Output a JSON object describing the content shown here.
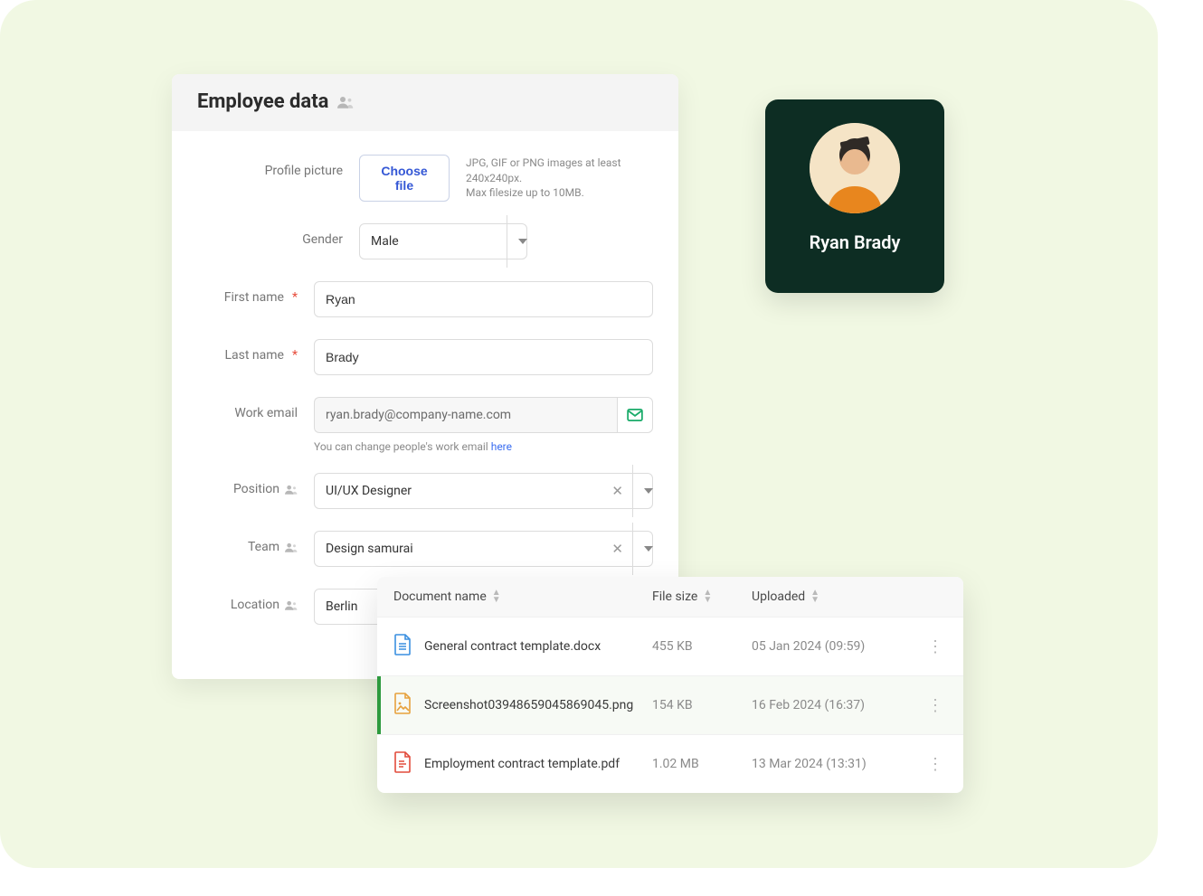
{
  "form": {
    "title": "Employee data",
    "labels": {
      "profile_picture": "Profile picture",
      "gender": "Gender",
      "first_name": "First name",
      "last_name": "Last name",
      "work_email": "Work email",
      "position": "Position",
      "team": "Team",
      "location": "Location"
    },
    "choose_file": "Choose file",
    "picture_hint_line1": "JPG, GIF or PNG images at least 240x240px.",
    "picture_hint_line2": "Max filesize up to 10MB.",
    "gender_value": "Male",
    "first_name_value": "Ryan",
    "last_name_value": "Brady",
    "work_email_value": "ryan.brady@company-name.com",
    "email_hint_prefix": "You can change people's work email ",
    "email_hint_link": "here",
    "position_value": "UI/UX Designer",
    "team_value": "Design samurai",
    "location_value": "Berlin"
  },
  "profile": {
    "name": "Ryan Brady"
  },
  "documents": {
    "headers": {
      "name": "Document name",
      "size": "File size",
      "uploaded": "Uploaded"
    },
    "rows": [
      {
        "icon_color": "#3a8fe0",
        "type": "doc",
        "name": "General contract template.docx",
        "size": "455 KB",
        "uploaded": "05 Jan 2024 (09:59)",
        "active": false
      },
      {
        "icon_color": "#e7a13d",
        "type": "img",
        "name": "Screenshot03948659045869045.png",
        "size": "154 KB",
        "uploaded": "16 Feb 2024 (16:37)",
        "active": true
      },
      {
        "icon_color": "#e24b3b",
        "type": "pdf",
        "name": "Employment contract template.pdf",
        "size": "1.02 MB",
        "uploaded": "13 Mar 2024 (13:31)",
        "active": false
      }
    ]
  }
}
